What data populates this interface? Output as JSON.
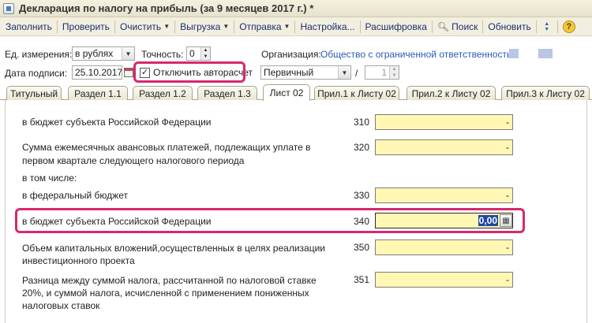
{
  "window": {
    "title": "Декларация по налогу на прибыль (за 9 месяцев 2017 г.) *"
  },
  "toolbar": {
    "fill": "Заполнить",
    "check": "Проверить",
    "clear": "Очистить",
    "export": "Выгрузка",
    "send": "Отправка",
    "settings": "Настройка...",
    "decode": "Расшифровка",
    "search": "Поиск",
    "refresh": "Обновить",
    "help": "?"
  },
  "header": {
    "units_label": "Ед. измерения:",
    "units_value": "в рублях",
    "precision_label": "Точность:",
    "precision_value": "0",
    "org_label": "Организация:",
    "org_value": "Общество с ограниченной ответственностью",
    "date_label": "Дата подписи:",
    "date_value": "25.10.2017",
    "autocalc_label": "Отключить авторасчет",
    "autocalc_checked": true,
    "kind_value": "Первичный",
    "slash": "/",
    "correction_value": "1"
  },
  "tabs": [
    {
      "label": "Титульный",
      "active": false
    },
    {
      "label": "Раздел 1.1",
      "active": false
    },
    {
      "label": "Раздел 1.2",
      "active": false
    },
    {
      "label": "Раздел 1.3",
      "active": false
    },
    {
      "label": "Лист 02",
      "active": true
    },
    {
      "label": "Прил.1 к Листу 02",
      "active": false
    },
    {
      "label": "Прил.2 к Листу 02",
      "active": false
    },
    {
      "label": "Прил.3 к Листу 02",
      "active": false
    }
  ],
  "rows": [
    {
      "text": "в бюджет субъекта Российской Федерации",
      "code": "310",
      "value": "-"
    },
    {
      "text": "Сумма ежемесячных авансовых платежей, подлежащих уплате в",
      "text2": "первом квартале следующего налогового периода",
      "code": "320",
      "value": "-"
    },
    {
      "text": "в том числе:"
    },
    {
      "text": "в федеральный бюджет",
      "code": "330",
      "value": "-"
    },
    {
      "text": "в бюджет субъекта Российской Федерации",
      "code": "340",
      "value": "0,00"
    },
    {
      "text": "Объем капитальных вложений,осуществленных в целях реализации",
      "text2": "инвестиционного проекта",
      "code": "350",
      "value": "-"
    },
    {
      "text": "Разница между суммой налога, рассчитанной по налоговой ставке",
      "text2": "20%, и суммой налога, исчисленной с применением пониженных",
      "text3": "налоговых ставок",
      "code": "351",
      "value": "-"
    }
  ],
  "colors": {
    "highlight": "#d7286d",
    "field_bg": "#fff7b3",
    "link": "#2a5ab8"
  }
}
